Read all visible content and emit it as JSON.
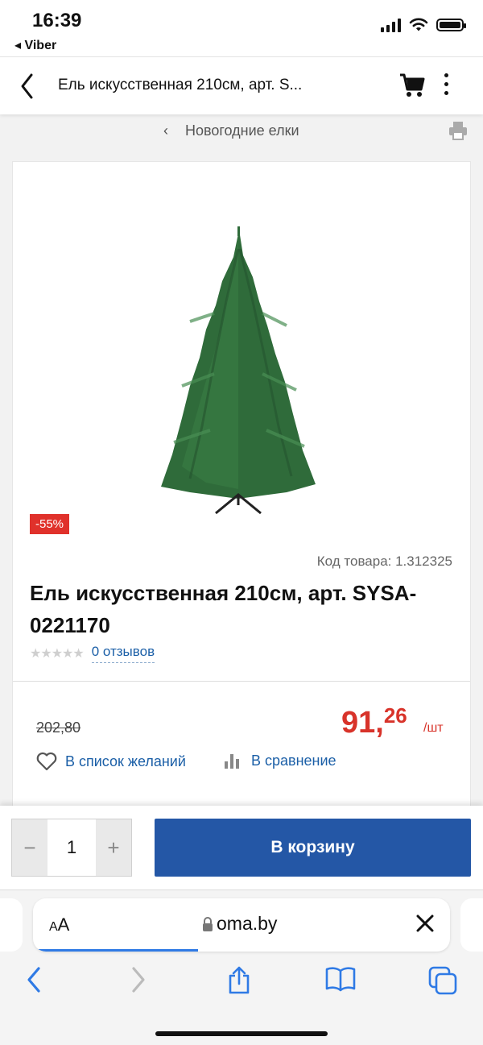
{
  "status_bar": {
    "time": "16:39",
    "back_app": "◂ Viber",
    "icons": [
      "signal-icon",
      "wifi-icon",
      "battery-icon"
    ]
  },
  "header": {
    "title": "Ель искусственная 210см, арт. S...",
    "icons": [
      "back-chevron-icon",
      "cart-icon",
      "more-vertical-icon"
    ]
  },
  "breadcrumb": {
    "arrow": "‹",
    "label": "Новогодние елки",
    "icon": "print-icon"
  },
  "product": {
    "discount_badge": "-55%",
    "code": "Код товара: 1.312325",
    "name": "Ель искусственная 210см, арт. SYSA-0221170",
    "stars": "★★★★★",
    "rating_value": 0,
    "reviews": "0 отзывов",
    "old_price": "202,80",
    "price_int": "91,",
    "price_cents": "26",
    "unit": "/шт",
    "wishlist": "В список желаний",
    "compare": "В сравнение",
    "colors": {
      "price": "#d8332a",
      "link": "#1b5fa7",
      "badge": "#e0312b"
    }
  },
  "purchase": {
    "minus": "−",
    "quantity": "1",
    "plus": "+",
    "add_to_cart": "В корзину",
    "button_color": "#2457a6"
  },
  "browser": {
    "aa_small": "A",
    "aa_big": "A",
    "url": "oma.by",
    "icons": [
      "lock-icon",
      "close-icon",
      "back-icon",
      "forward-icon",
      "share-icon",
      "bookmarks-icon",
      "tabs-icon"
    ]
  }
}
